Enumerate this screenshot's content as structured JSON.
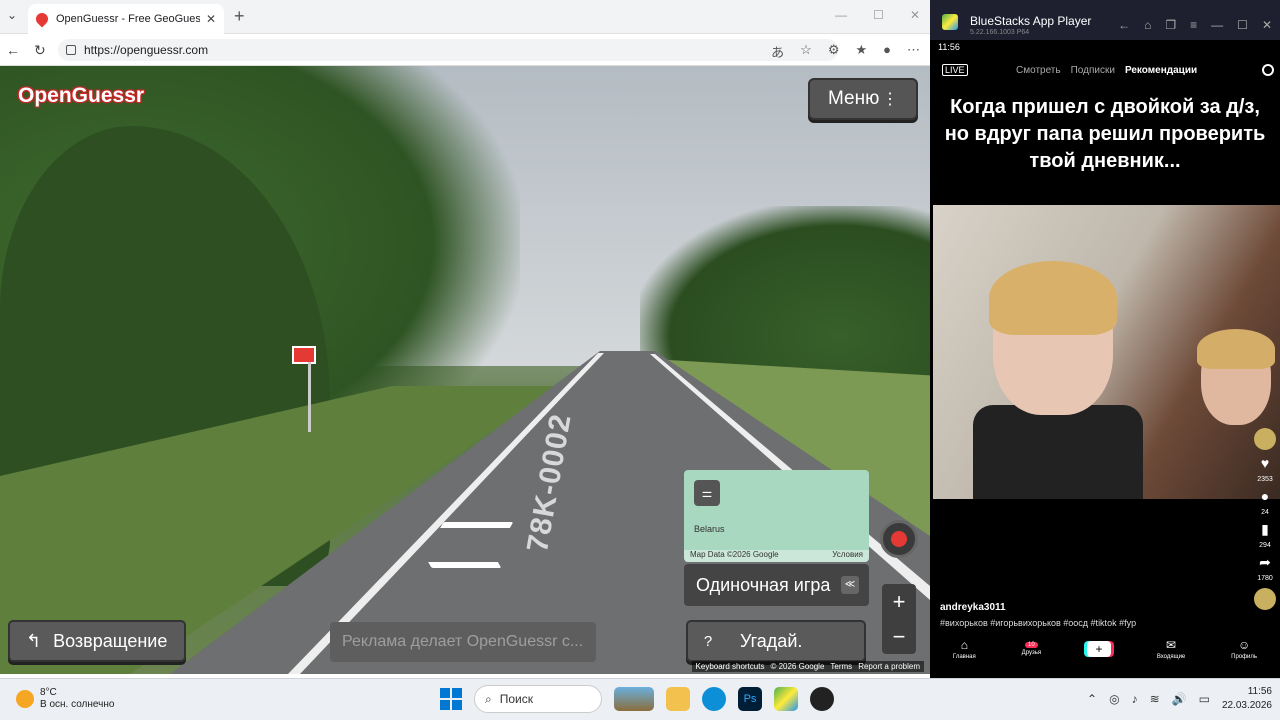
{
  "browser": {
    "tab_title": "OpenGuessr - Free GeoGuessr Alte",
    "url": "https://openguessr.com"
  },
  "game": {
    "logo": "OpenGuessr",
    "menu_label": "Меню",
    "map_country": "Belarus",
    "map_data": "Map Data ©2026 Google",
    "map_terms": "Условия",
    "single_game_label": "Одиночная игра",
    "back_label": "Возвращение",
    "ad_text": "Реклама делает OpenGuessr с...",
    "guess_label": "Угадай.",
    "guess_icon": "?",
    "road_marking": "78K-0002",
    "footer": [
      "Keyboard shortcuts",
      "© 2026 Google",
      "Terms",
      "Report a problem"
    ]
  },
  "bluestacks": {
    "title": "BlueStacks App Player",
    "version": "5.22.166.1003 P64",
    "status_time": "11:56",
    "tiktok": {
      "live": "LIVE",
      "tabs": [
        "Смотреть",
        "Подписки",
        "Рекомендации"
      ],
      "caption": "Когда пришел с двойкой за д/з, но вдруг папа решил проверить твой дневник...",
      "likes": "2353",
      "comments": "24",
      "saves": "294",
      "shares": "1780",
      "username": "andreyka3011",
      "hashtags": "#вихорьков #игорьвихорьков #оосд #tiktok #fyp",
      "nav": [
        "Главная",
        "Друзья",
        "Входящие",
        "Профиль"
      ],
      "friends_badge": "10"
    }
  },
  "taskbar": {
    "temperature": "8°C",
    "weather_text": "В осн. солнечно",
    "search_label": "Поиск",
    "time": "11:56",
    "date": "22.03.2026"
  }
}
